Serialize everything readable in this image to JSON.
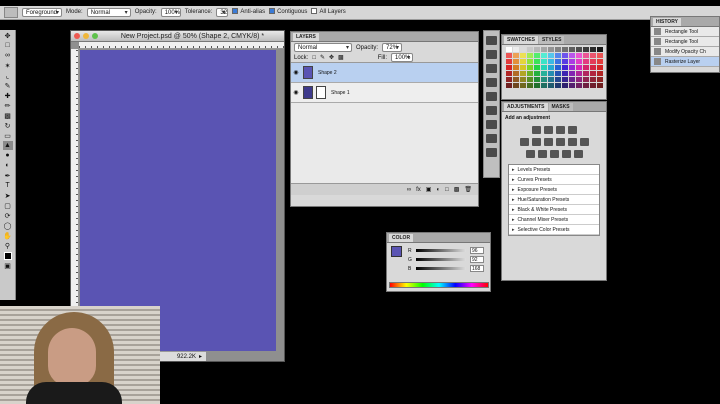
{
  "options_bar": {
    "fill_source": "Foreground",
    "mode_label": "Mode:",
    "mode_value": "Normal",
    "opacity_label": "Opacity:",
    "opacity_value": "100%",
    "tolerance_label": "Tolerance:",
    "tolerance_value": "32",
    "anti_alias_label": "Anti-alias",
    "contiguous_label": "Contiguous",
    "all_layers_label": "All Layers"
  },
  "document": {
    "title": "New Project.psd @ 50% (Shape 2, CMYK/8) *",
    "status_size": "922.2K",
    "canvas_color": "#5a54b3"
  },
  "layers_panel": {
    "tab": "LAYERS",
    "blend_mode": "Normal",
    "opacity_label": "Opacity:",
    "opacity_value": "72%",
    "lock_label": "Lock:",
    "fill_label": "Fill:",
    "fill_value": "100%",
    "layers": [
      {
        "name": "Shape 2",
        "selected": true
      },
      {
        "name": "Shape 1",
        "selected": false
      }
    ]
  },
  "swatches_panel": {
    "tabs": [
      "SWATCHES",
      "STYLES"
    ]
  },
  "adjustments_panel": {
    "tabs": [
      "ADJUSTMENTS",
      "MASKS"
    ],
    "title": "Add an adjustment",
    "presets": [
      "Levels Presets",
      "Curves Presets",
      "Exposure Presets",
      "Hue/Saturation Presets",
      "Black & White Presets",
      "Channel Mixer Presets",
      "Selective Color Presets"
    ]
  },
  "history_panel": {
    "tab": "HISTORY",
    "items": [
      {
        "label": "Rectangle Tool",
        "selected": false
      },
      {
        "label": "Rectangle Tool",
        "selected": false
      },
      {
        "label": "Modify Opacity Ch",
        "selected": false
      },
      {
        "label": "Rasterize Layer",
        "selected": true
      }
    ]
  },
  "color_panel": {
    "tab": "COLOR",
    "channels": [
      {
        "name": "R",
        "value": "96"
      },
      {
        "name": "G",
        "value": "92"
      },
      {
        "name": "B",
        "value": "168"
      }
    ]
  }
}
